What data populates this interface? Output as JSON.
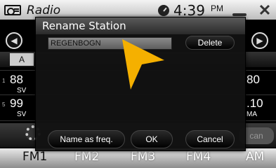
{
  "topbar": {
    "title": "Radio",
    "time": "4:39",
    "ampm": "PM"
  },
  "band_chip": "A",
  "presets_left": [
    {
      "num": "1",
      "freq": "88",
      "sub": "SV"
    },
    {
      "num": "5",
      "freq": "99",
      "sub": "SV"
    }
  ],
  "presets_right": [
    {
      "freq": "80",
      "sub": ""
    },
    {
      "freq": ".10",
      "sub": "MA"
    }
  ],
  "scan_label": "can",
  "band_tabs": [
    "FM1",
    "FM2",
    "FM3",
    "FM4",
    "AM"
  ],
  "active_band": "FM1",
  "dialog": {
    "title": "Rename Station",
    "name_value": "REGENBOGN",
    "delete_label": "Delete",
    "name_as_freq_label": "Name as freq.",
    "ok_label": "OK",
    "cancel_label": "Cancel"
  },
  "colors": {
    "pointer": "#f5b000",
    "accent_bar": "#5a5a5a"
  },
  "icons": [
    "radio-icon",
    "clock-icon",
    "minimize-icon",
    "close-icon",
    "prev-icon",
    "next-icon",
    "gear-icon",
    "pointer-arrow-icon"
  ]
}
